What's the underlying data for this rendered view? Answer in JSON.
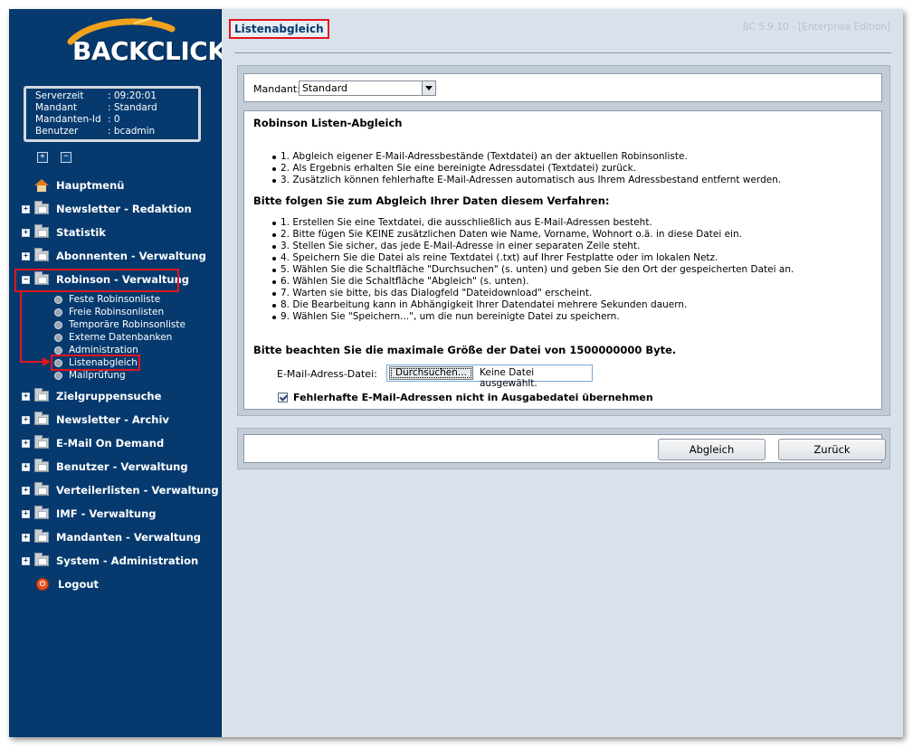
{
  "brand": {
    "logo_text": "BACKCLICK"
  },
  "info": {
    "rows": [
      {
        "key": "Serverzeit",
        "value": ": 09:20:01"
      },
      {
        "key": "Mandant",
        "value": ": Standard"
      },
      {
        "key": "Mandanten-Id",
        "value": ": 0"
      },
      {
        "key": "Benutzer",
        "value": ": bcadmin"
      }
    ]
  },
  "tree_controls": {
    "expand": "+",
    "collapse": "−"
  },
  "nav": {
    "hauptmenu": "Hauptmenü",
    "items": [
      "Newsletter - Redaktion",
      "Statistik",
      "Abonnenten - Verwaltung",
      "Robinson - Verwaltung",
      "Zielgruppensuche",
      "Newsletter - Archiv",
      "E-Mail On Demand",
      "Benutzer - Verwaltung",
      "Verteilerlisten - Verwaltung",
      "IMF - Verwaltung",
      "Mandanten - Verwaltung",
      "System - Administration"
    ],
    "logout": "Logout",
    "sub_items": [
      "Feste Robinsonliste",
      "Freie Robinsonlisten",
      "Temporäre Robinsonliste",
      "Externe Datenbanken",
      "Administration",
      "Listenabgleich",
      "Mailprüfung"
    ]
  },
  "header": {
    "title": "Listenabgleich",
    "version": "BC 5.9.10 - [Enterprise Edition]"
  },
  "mandant": {
    "label": "Mandant:",
    "selected": "Standard"
  },
  "content": {
    "heading": "Robinson Listen-Abgleich",
    "intro_list": [
      "1. Abgleich eigener E-Mail-Adressbestände (Textdatei) an der aktuellen Robinsonliste.",
      "2. Als Ergebnis erhalten Sie eine bereinigte Adressdatei (Textdatei) zurück.",
      "3. Zusätzlich können fehlerhafte E-Mail-Adressen automatisch aus Ihrem Adressbestand entfernt werden."
    ],
    "steps_heading": "Bitte folgen Sie zum Abgleich Ihrer Daten diesem Verfahren:",
    "steps": [
      "1. Erstellen Sie eine Textdatei, die ausschließlich aus E-Mail-Adressen besteht.",
      "2. Bitte fügen Sie KEINE zusätzlichen Daten wie Name, Vorname, Wohnort o.ä. in diese Datei ein.",
      "3. Stellen Sie sicher, das jede E-Mail-Adresse in einer separaten Zeile steht.",
      "4. Speichern Sie die Datei als reine Textdatei (.txt) auf Ihrer Festplatte oder im lokalen Netz.",
      "5. Wählen Sie die Schaltfläche \"Durchsuchen\" (s. unten) und geben Sie den Ort der gespeicherten Datei an.",
      "6. Wählen Sie die Schaltfläche \"Abgleich\" (s. unten).",
      "7. Warten sie bitte, bis das Dialogfeld \"Dateidownload\" erscheint.",
      "8. Die Bearbeitung kann in Abhängigkeit Ihrer Datendatei mehrere Sekunden dauern.",
      "9. Wählen Sie \"Speichern...\", um die nun bereinigte Datei zu speichern."
    ],
    "note": "Bitte beachten Sie die maximale Größe der Datei von 1500000000 Byte.",
    "file_label": "E-Mail-Adress-Datei:",
    "file_button": "Durchsuchen...",
    "file_status": "Keine Datei ausgewählt.",
    "checkbox_label": "Fehlerhafte E-Mail-Adressen nicht in Ausgabedatei übernehmen"
  },
  "buttons": {
    "abgleich": "Abgleich",
    "zurueck": "Zurück"
  },
  "colors": {
    "sidebar": "#063a6e",
    "highlight": "#e4151e",
    "main_bg": "#d9e1ea"
  }
}
